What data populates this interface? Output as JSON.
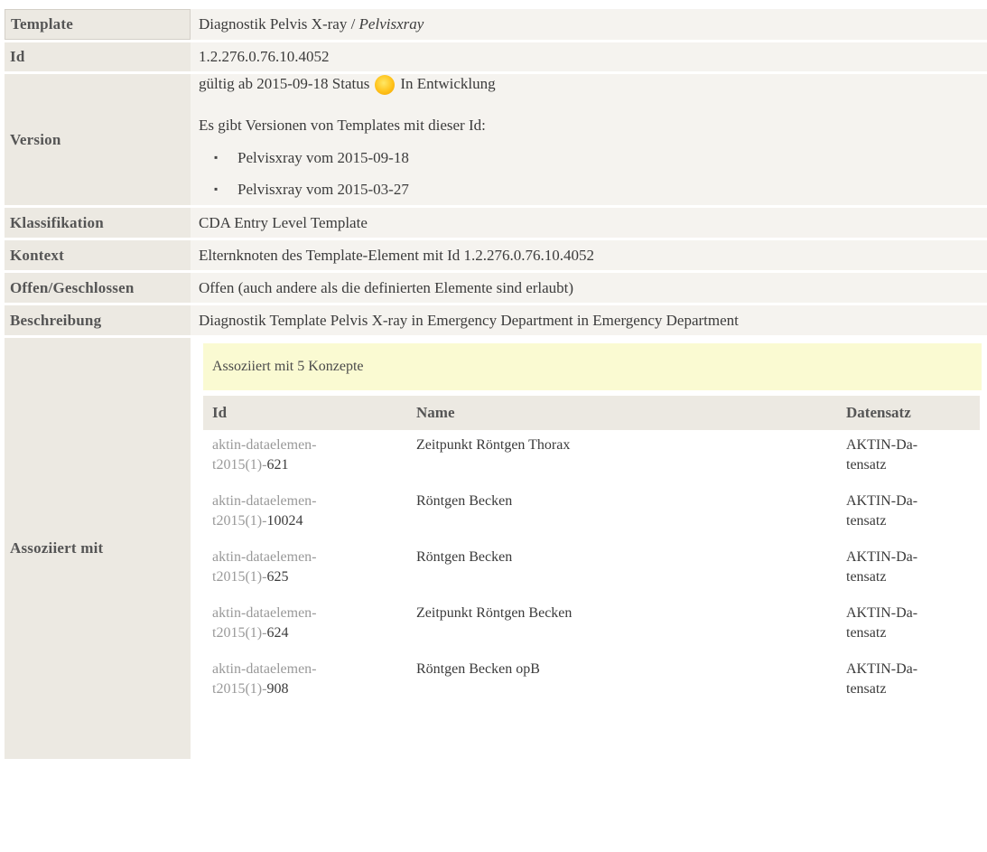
{
  "rows": {
    "template": {
      "label": "Template",
      "value": "Diagnostik Pelvis X-ray / ",
      "value_italic": "Pelvisxray"
    },
    "id": {
      "label": "Id",
      "value": "1.2.276.0.76.10.4052"
    },
    "version": {
      "label": "Version",
      "valid_prefix": "gültig ab 2015-09-18 Status",
      "status_text": "In Entwicklung",
      "status_color": "#ffc21a",
      "versions_intro": "Es gibt Versionen von Templates mit dieser Id:",
      "versions": [
        {
          "text": "Pelvisxray vom 2015-09-18"
        },
        {
          "text": "Pelvisxray vom 2015-03-27"
        }
      ]
    },
    "klassifikation": {
      "label": "Klassifikation",
      "value": "CDA Entry Level Template"
    },
    "kontext": {
      "label": "Kontext",
      "value": "Elternknoten des Template-Element mit Id 1.2.276.0.76.10.4052"
    },
    "offen": {
      "label": "Offen/Geschlossen",
      "value": "Offen (auch andere als die definierten Elemente sind erlaubt)"
    },
    "beschreibung": {
      "label": "Beschreibung",
      "value": "Diagnostik Template Pelvis X-ray in Emergency Department in Emergency Department"
    },
    "assoziiert": {
      "label": "Assoziiert mit",
      "box_text": "Assoziiert mit 5 Konzepte",
      "headers": {
        "id": "Id",
        "name": "Name",
        "datensatz": "Datensatz"
      },
      "concepts": [
        {
          "id_line1": "aktin-dataelemen-",
          "id_line2": "t2015(1)-",
          "id_num": "621",
          "name": "Zeitpunkt Röntgen Thorax",
          "ds_line1": "AKTIN-Da-",
          "ds_line2": "tensatz"
        },
        {
          "id_line1": "aktin-dataelemen-",
          "id_line2": "t2015(1)-",
          "id_num": "10024",
          "name": "Röntgen Becken",
          "ds_line1": "AKTIN-Da-",
          "ds_line2": "tensatz"
        },
        {
          "id_line1": "aktin-dataelemen-",
          "id_line2": "t2015(1)-",
          "id_num": "625",
          "name": "Röntgen Becken",
          "ds_line1": "AKTIN-Da-",
          "ds_line2": "tensatz"
        },
        {
          "id_line1": "aktin-dataelemen-",
          "id_line2": "t2015(1)-",
          "id_num": "624",
          "name": "Zeitpunkt Röntgen Becken",
          "ds_line1": "AKTIN-Da-",
          "ds_line2": "tensatz"
        },
        {
          "id_line1": "aktin-dataelemen-",
          "id_line2": "t2015(1)-",
          "id_num": "908",
          "name": "Röntgen Becken opB",
          "ds_line1": "AKTIN-Da-",
          "ds_line2": "tensatz"
        }
      ]
    }
  }
}
